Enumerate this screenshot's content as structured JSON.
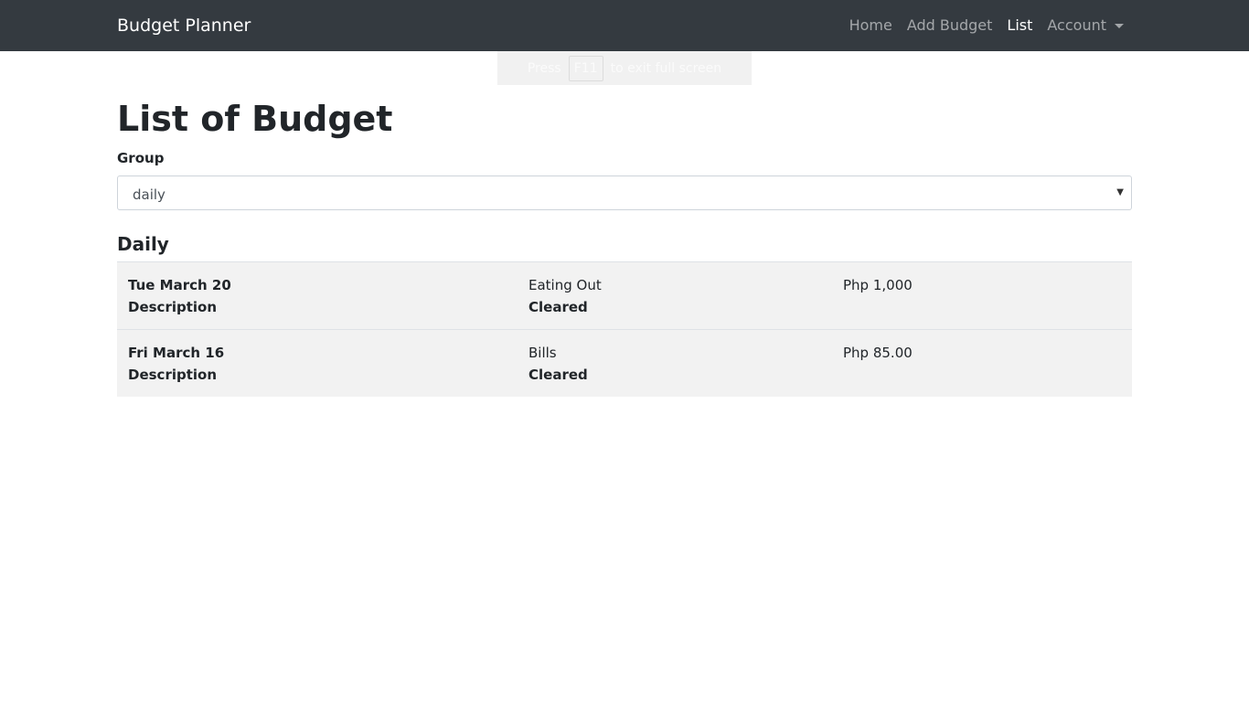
{
  "navbar": {
    "brand": "Budget Planner",
    "links": [
      {
        "label": "Home",
        "active": false
      },
      {
        "label": "Add Budget",
        "active": false
      },
      {
        "label": "List",
        "active": true
      },
      {
        "label": "Account",
        "active": false
      }
    ]
  },
  "fullscreen_notice": {
    "before": "Press",
    "key": "F11",
    "after": "to exit full screen"
  },
  "page": {
    "title": "List of Budget",
    "group_label": "Group",
    "group_selected": "daily",
    "section_heading": "Daily"
  },
  "budgets": [
    {
      "date": "Tue March 20",
      "description_label": "Description",
      "category": "Eating Out",
      "status": "Cleared",
      "amount": "Php 1,000"
    },
    {
      "date": "Fri March 16",
      "description_label": "Description",
      "category": "Bills",
      "status": "Cleared",
      "amount": "Php 85.00"
    }
  ],
  "colors": {
    "navbar_bg": "#343a40",
    "row_bg": "#f2f2f2",
    "text": "#212529"
  }
}
